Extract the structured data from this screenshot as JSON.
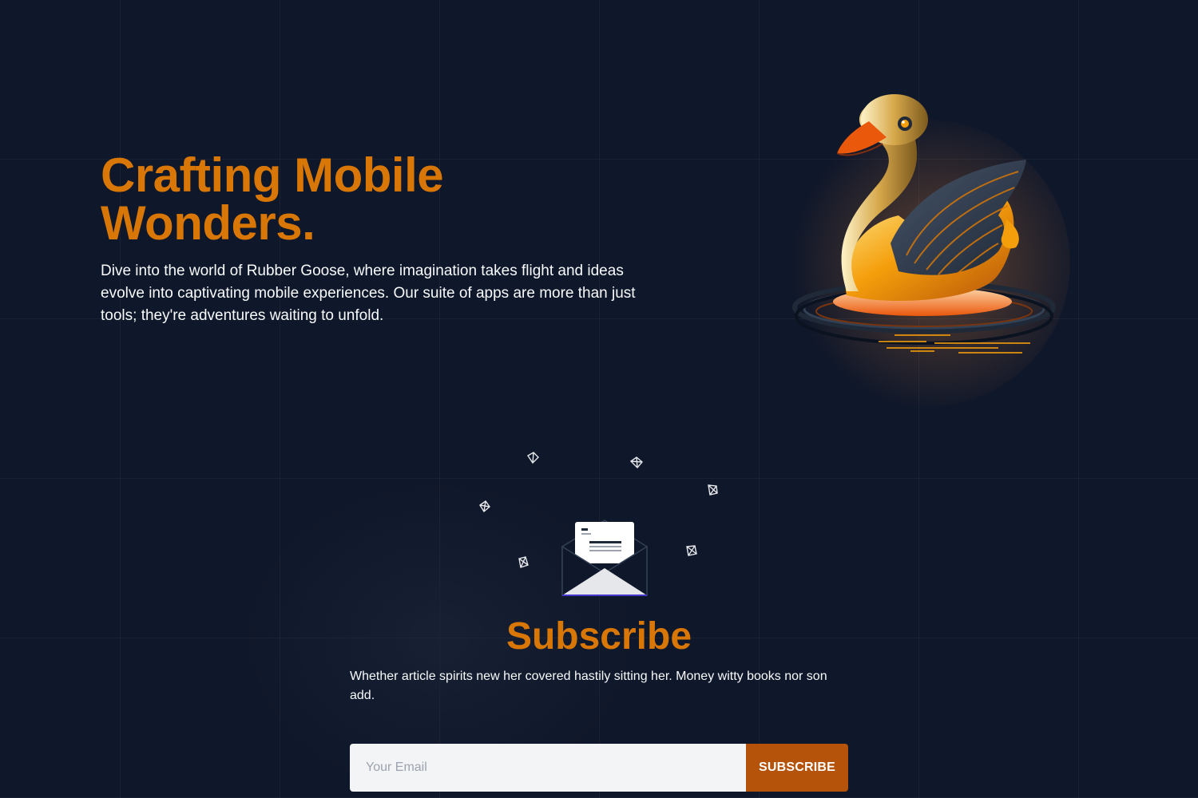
{
  "hero": {
    "title_line1": "Crafting Mobile",
    "title_line2": "Wonders.",
    "description": "Dive into the world of Rubber Goose, where imagination takes flight and ideas evolve into captivating mobile experiences. Our suite of apps are more than just tools; they're adventures waiting to unfold.",
    "image_icon": "golden-goose-illustration"
  },
  "subscribe": {
    "illustration_icon": "open-envelope-icon",
    "title": "Subscribe",
    "description": "Whether article spirits new her covered hastily sitting her. Money witty books nor son add.",
    "email_placeholder": "Your Email",
    "button_label": "SUBSCRIBE"
  },
  "colors": {
    "background": "#0f172a",
    "accent": "#d97706",
    "button": "#b45309",
    "text": "#f8fafc",
    "input_bg": "#f3f4f6"
  }
}
